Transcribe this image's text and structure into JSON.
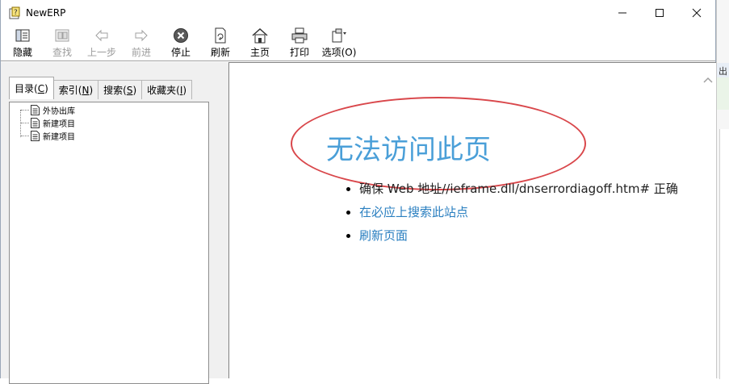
{
  "window": {
    "title": "NewERP"
  },
  "toolbar": {
    "hide": "隐藏",
    "find": "查找",
    "back": "上一步",
    "forward": "前进",
    "stop": "停止",
    "refresh": "刷新",
    "home": "主页",
    "print": "打印",
    "options": "选项(O)"
  },
  "tabs": [
    {
      "pre": "目录(",
      "key": "C",
      "post": ")"
    },
    {
      "pre": "索引(",
      "key": "N",
      "post": ")"
    },
    {
      "pre": "搜索(",
      "key": "S",
      "post": ")"
    },
    {
      "pre": "收藏夹(",
      "key": "I",
      "post": ")"
    }
  ],
  "tree": {
    "items": [
      "外协出库",
      "新建项目",
      "新建项目"
    ]
  },
  "content": {
    "title": "无法访问此页",
    "items": [
      "确保 Web 地址//ieframe.dll/dnserrordiagoff.htm# 正确",
      "在必应上搜索此站点",
      "刷新页面"
    ]
  },
  "background": {
    "fragment": "出"
  },
  "colors": {
    "title_blue": "#4a9fd8",
    "link_blue": "#2a7fc0",
    "ellipse_red": "#d9474b"
  }
}
